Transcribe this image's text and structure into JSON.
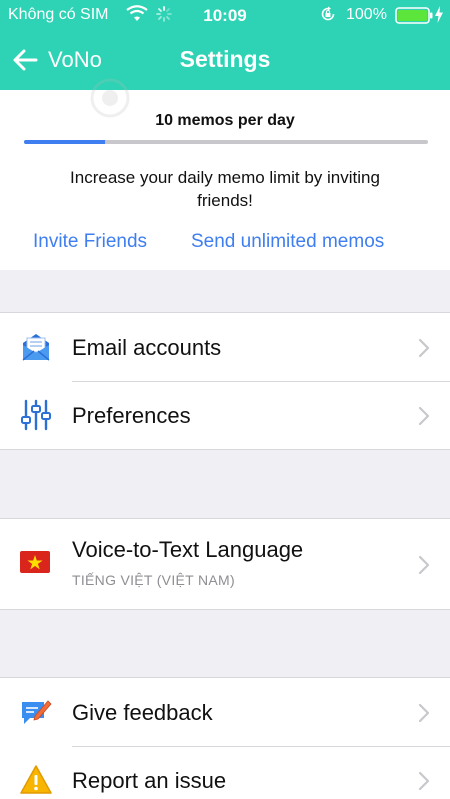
{
  "status_bar": {
    "carrier": "Không có SIM",
    "time": "10:09",
    "battery_percent": "100%",
    "icons": [
      "wifi-icon",
      "activity-spinner-icon",
      "rotation-lock-icon",
      "battery-icon",
      "charging-icon"
    ]
  },
  "nav": {
    "back_label": "VoNo",
    "title": "Settings"
  },
  "memo": {
    "count_label": "10 memos per day",
    "progress": 0.2,
    "info": "Increase your daily memo limit by inviting friends!",
    "invite_label": "Invite Friends",
    "unlimited_label": "Send unlimited memos"
  },
  "group_accounts": {
    "items": [
      {
        "label": "Email accounts",
        "icon": "email-icon"
      },
      {
        "label": "Preferences",
        "icon": "sliders-icon"
      }
    ]
  },
  "group_language": {
    "label": "Voice-to-Text Language",
    "value": "TIẾNG VIỆT (VIỆT NAM)",
    "icon": "vietnam-flag-icon"
  },
  "group_support": {
    "items": [
      {
        "label": "Give feedback",
        "icon": "feedback-icon"
      },
      {
        "label": "Report an issue",
        "icon": "warning-icon"
      }
    ]
  },
  "colors": {
    "header": "#2dd3b4",
    "accent": "#3f7ef0",
    "background": "#efeff4"
  }
}
